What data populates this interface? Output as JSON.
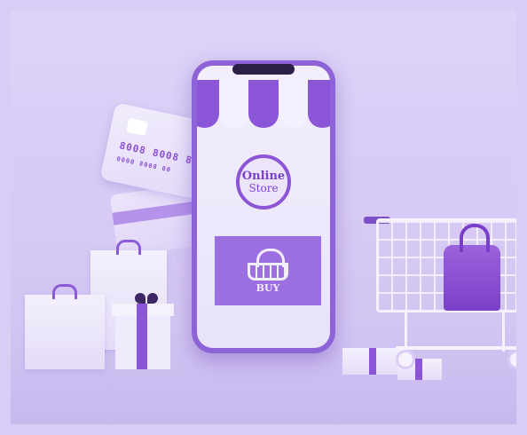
{
  "store_badge": {
    "line1": "Online",
    "line2": "Store"
  },
  "buy_panel": {
    "label": "BUY",
    "icon": "shopping-basket-icon"
  },
  "credit_card": {
    "number_line": "8008 8008 8008",
    "small_line": "0000 8008 00"
  },
  "colors": {
    "background": "#d8cdf5",
    "accent": "#8a55d6",
    "light": "#f4f0fd"
  }
}
